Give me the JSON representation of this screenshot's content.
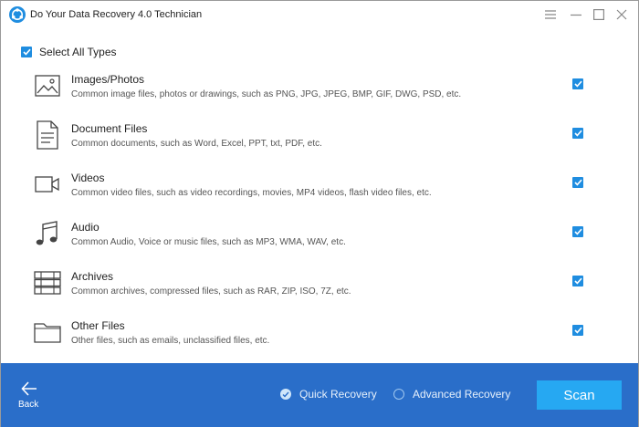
{
  "window": {
    "title": "Do Your Data Recovery 4.0 Technician",
    "controls": [
      "menu-icon",
      "minimize-icon",
      "maximize-icon",
      "close-icon"
    ]
  },
  "select_all": {
    "label": "Select All Types",
    "checked": true
  },
  "categories": [
    {
      "name": "Images/Photos",
      "description": "Common image files, photos or drawings, such as PNG, JPG, JPEG, BMP, GIF, DWG, PSD, etc.",
      "icon": "image-icon",
      "checked": true
    },
    {
      "name": "Document Files",
      "description": "Common documents, such as Word, Excel, PPT, txt, PDF, etc.",
      "icon": "document-icon",
      "checked": true
    },
    {
      "name": "Videos",
      "description": "Common video files, such as video recordings, movies, MP4 videos, flash video files, etc.",
      "icon": "video-camera-icon",
      "checked": true
    },
    {
      "name": "Audio",
      "description": "Common Audio, Voice or music files, such as MP3, WMA, WAV, etc.",
      "icon": "music-note-icon",
      "checked": true
    },
    {
      "name": "Archives",
      "description": "Common archives, compressed files, such as RAR, ZIP, ISO, 7Z, etc.",
      "icon": "archive-icon",
      "checked": true
    },
    {
      "name": "Other Files",
      "description": "Other files, such as emails, unclassified files, etc.",
      "icon": "folder-icon",
      "checked": true
    }
  ],
  "bottom": {
    "back_label": "Back",
    "quick_recovery": {
      "label": "Quick Recovery",
      "selected": true
    },
    "advanced_recovery": {
      "label": "Advanced Recovery",
      "selected": false
    },
    "scan_label": "Scan"
  },
  "colors": {
    "accent": "#1f8de0",
    "bottom_bar": "#2a6ec9",
    "scan_button": "#26a8f2"
  }
}
